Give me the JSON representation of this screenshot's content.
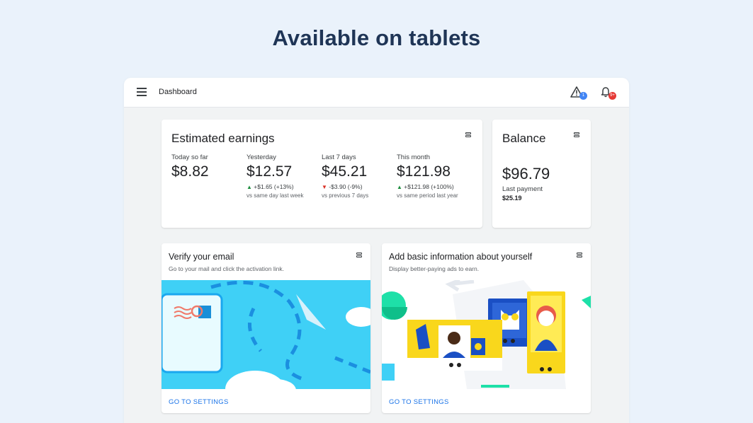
{
  "headline": "Available on tablets",
  "appbar": {
    "title": "Dashboard",
    "warning_count": "1",
    "notification_count": "9+"
  },
  "earnings": {
    "title": "Estimated earnings",
    "stats": [
      {
        "label": "Today so far",
        "value": "$8.82",
        "change": "",
        "comparison": ""
      },
      {
        "label": "Yesterday",
        "value": "$12.57",
        "change": "+$1.65 (+13%)",
        "direction": "up",
        "comparison": "vs same day last week"
      },
      {
        "label": "Last 7 days",
        "value": "$45.21",
        "change": "-$3.90 (-9%)",
        "direction": "down",
        "comparison": "vs previous 7 days"
      },
      {
        "label": "This month",
        "value": "$121.98",
        "change": "+$121.98 (+100%)",
        "direction": "up",
        "comparison": "vs same period last year"
      }
    ]
  },
  "balance": {
    "title": "Balance",
    "value": "$96.79",
    "last_payment_label": "Last payment",
    "last_payment_value": "$25.19"
  },
  "tasks": [
    {
      "title": "Verify your email",
      "subtitle": "Go to your mail and click the activation link.",
      "link": "GO TO SETTINGS"
    },
    {
      "title": "Add basic information about yourself",
      "subtitle": "Display better-paying ads to earn.",
      "link": "GO TO SETTINGS"
    }
  ],
  "colors": {
    "background": "#eaf2fb",
    "headline": "#1f3556",
    "link": "#1a73e8",
    "up": "#1e8e3e",
    "down": "#d93025",
    "illustration_cyan": "#3fd0f6",
    "illustration_yellow": "#f9d71c",
    "illustration_blue": "#1a4fc4"
  },
  "icons": [
    "menu-icon",
    "warning-icon",
    "bell-icon",
    "card-menu-icon"
  ]
}
